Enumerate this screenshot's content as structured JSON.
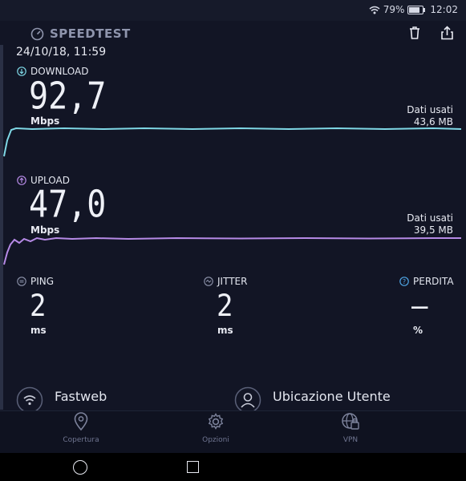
{
  "status": {
    "battery": "79%",
    "time": "12:02",
    "battery_level": 0.79
  },
  "header": {
    "brand": "SPEEDTEST"
  },
  "test": {
    "datetime": "24/10/18, 11:59",
    "download": {
      "label": "DOWNLOAD",
      "value": "92,7",
      "unit": "Mbps",
      "data_label": "Dati usati",
      "data_value": "43,6 MB"
    },
    "upload": {
      "label": "UPLOAD",
      "value": "47,0",
      "unit": "Mbps",
      "data_label": "Dati usati",
      "data_value": "39,5 MB"
    }
  },
  "metrics": {
    "ping": {
      "label": "PING",
      "value": "2",
      "unit": "ms"
    },
    "jitter": {
      "label": "JITTER",
      "value": "2",
      "unit": "ms"
    },
    "loss": {
      "label": "PERDITA",
      "value": "–",
      "unit": "%"
    }
  },
  "info": {
    "provider": {
      "title": "Fastweb"
    },
    "location": {
      "title": "Ubicazione Utente"
    }
  },
  "nav": {
    "items": [
      {
        "label": "Copertura"
      },
      {
        "label": "Opzioni"
      },
      {
        "label": "VPN"
      }
    ]
  },
  "colors": {
    "background": "#121525",
    "download_line": "#7fd8e6",
    "upload_line": "#b68ae6",
    "accent_icon": "#4fa6e6"
  }
}
